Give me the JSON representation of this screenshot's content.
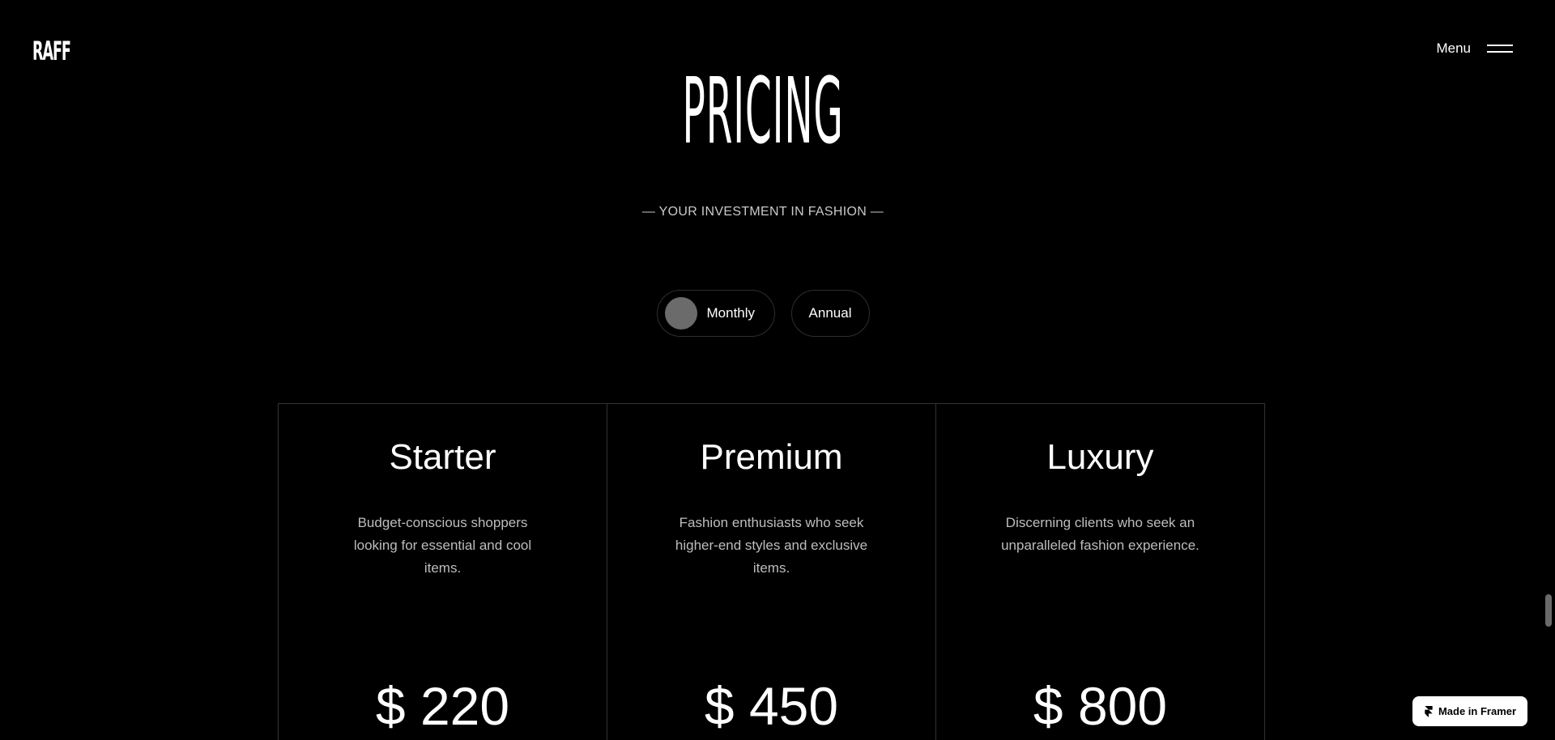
{
  "header": {
    "logo": "RAFF",
    "menu_label": "Menu",
    "menu_icon": "hamburger-icon"
  },
  "hero": {
    "title": "PRICING",
    "subtitle": "— YOUR INVESTMENT IN FASHION —"
  },
  "billing_toggle": {
    "options": [
      {
        "label": "Monthly",
        "selected": true
      },
      {
        "label": "Annual",
        "selected": false
      }
    ]
  },
  "plans": [
    {
      "name": "Starter",
      "description": "Budget-conscious shoppers looking for essential and cool items.",
      "price": "$ 220"
    },
    {
      "name": "Premium",
      "description": "Fashion enthusiasts who seek higher-end styles and exclusive items.",
      "price": "$ 450"
    },
    {
      "name": "Luxury",
      "description": "Discerning clients who seek an unparalleled fashion experience.",
      "price": "$ 800"
    }
  ],
  "badge": {
    "label": "Made in Framer",
    "icon": "framer-icon"
  },
  "colors": {
    "background": "#000000",
    "text": "#ffffff",
    "muted_text": "#bdbdbd",
    "border": "#333333",
    "toggle_knob": "#6b6b6b"
  }
}
